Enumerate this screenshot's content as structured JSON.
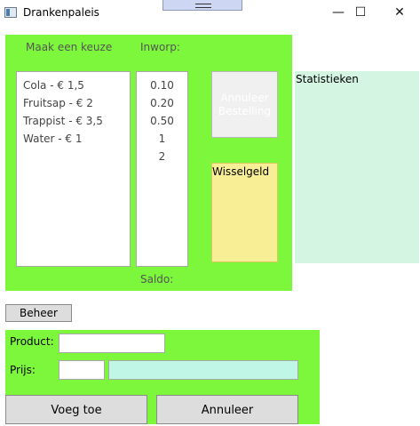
{
  "window": {
    "title": "Drankenpaleis",
    "minimize_glyph": "—",
    "maximize_glyph": "☐",
    "close_glyph": "✕"
  },
  "order": {
    "choice_label": "Maak een keuze",
    "coins_label": "Inworp:",
    "drinks": [
      "Cola - € 1,5",
      "Fruitsap - € 2",
      "Trappist - € 3,5",
      "Water - € 1"
    ],
    "coins": [
      "0.10",
      "0.20",
      "0.50",
      "1",
      "2"
    ],
    "cancel_order_label": "Annuleer Bestelling",
    "change_label": "Wisselgeld",
    "balance_label": "Saldo:"
  },
  "stats": {
    "label": "Statistieken"
  },
  "admin": {
    "button_label": "Beheer",
    "product_label": "Product:",
    "product_value": "",
    "price_label": "Prijs:",
    "price_value": "",
    "add_label": "Voeg toe",
    "cancel_label": "Annuleer"
  },
  "colors": {
    "panel_green": "#7cf73c",
    "change_yellow": "#f7ee96",
    "stats_mint": "#d5f5e3",
    "info_field": "#bff6e6"
  }
}
